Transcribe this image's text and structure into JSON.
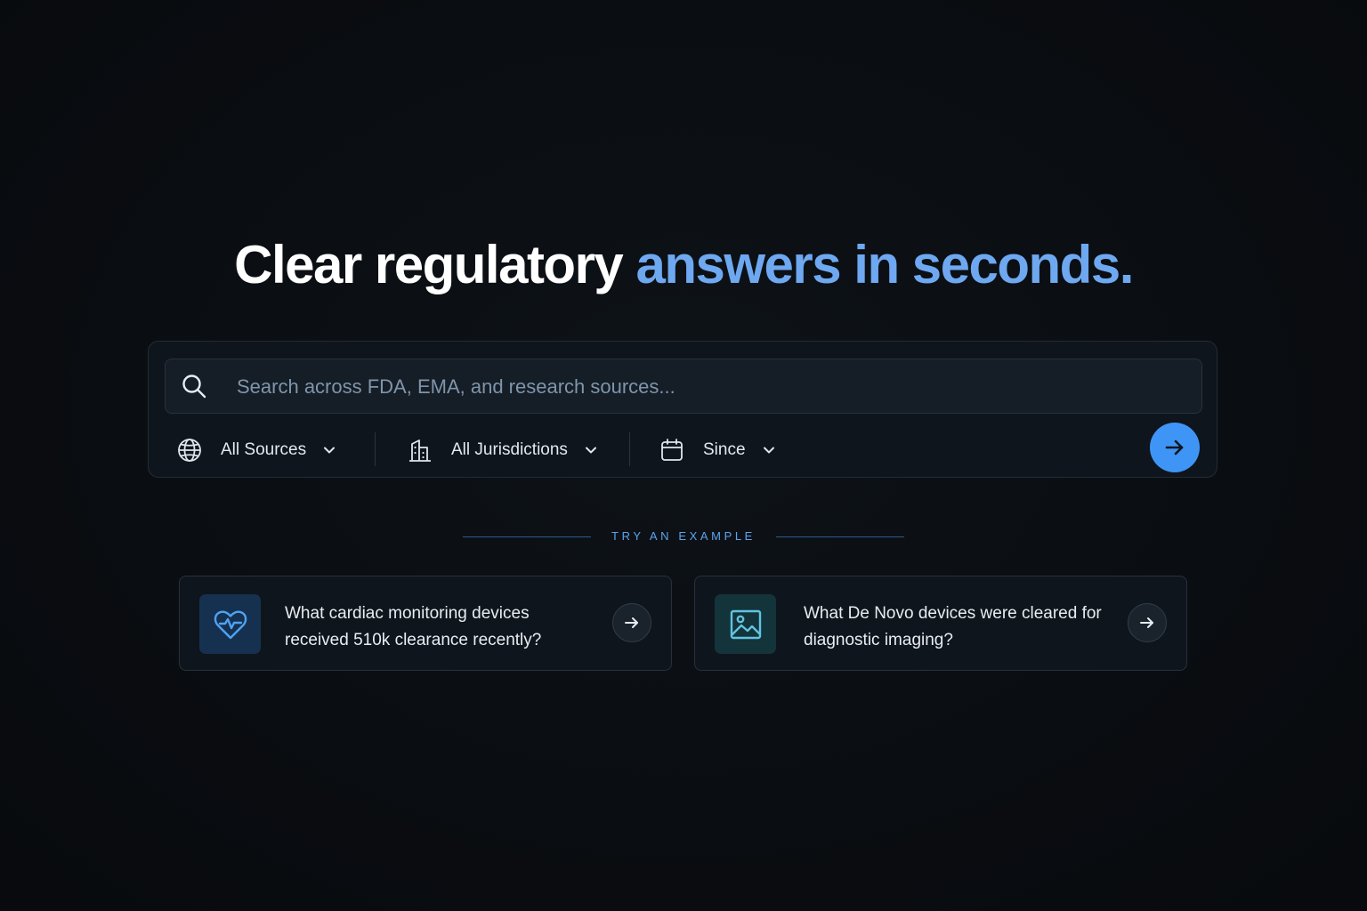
{
  "headline": {
    "main": "Clear regulatory ",
    "accent": "answers in seconds."
  },
  "search": {
    "placeholder": "Search across FDA, EMA, and research sources...",
    "value": ""
  },
  "filters": {
    "sources": {
      "label": "All Sources",
      "icon": "globe-icon"
    },
    "jurisdictions": {
      "label": "All Jurisdictions",
      "icon": "building-icon"
    },
    "since": {
      "label": "Since",
      "icon": "calendar-icon"
    }
  },
  "submit": {
    "icon": "arrow-right-icon"
  },
  "examples": {
    "heading": "TRY AN EXAMPLE",
    "items": [
      {
        "icon": "heart-pulse-icon",
        "text": "What cardiac monitoring devices received 510k clearance recently?"
      },
      {
        "icon": "image-icon",
        "text": "What De Novo devices were cleared for diagnostic imaging?"
      }
    ]
  },
  "colors": {
    "background": "#0a0d11",
    "accent": "#6ea8f0",
    "button": "#3f95f5"
  }
}
